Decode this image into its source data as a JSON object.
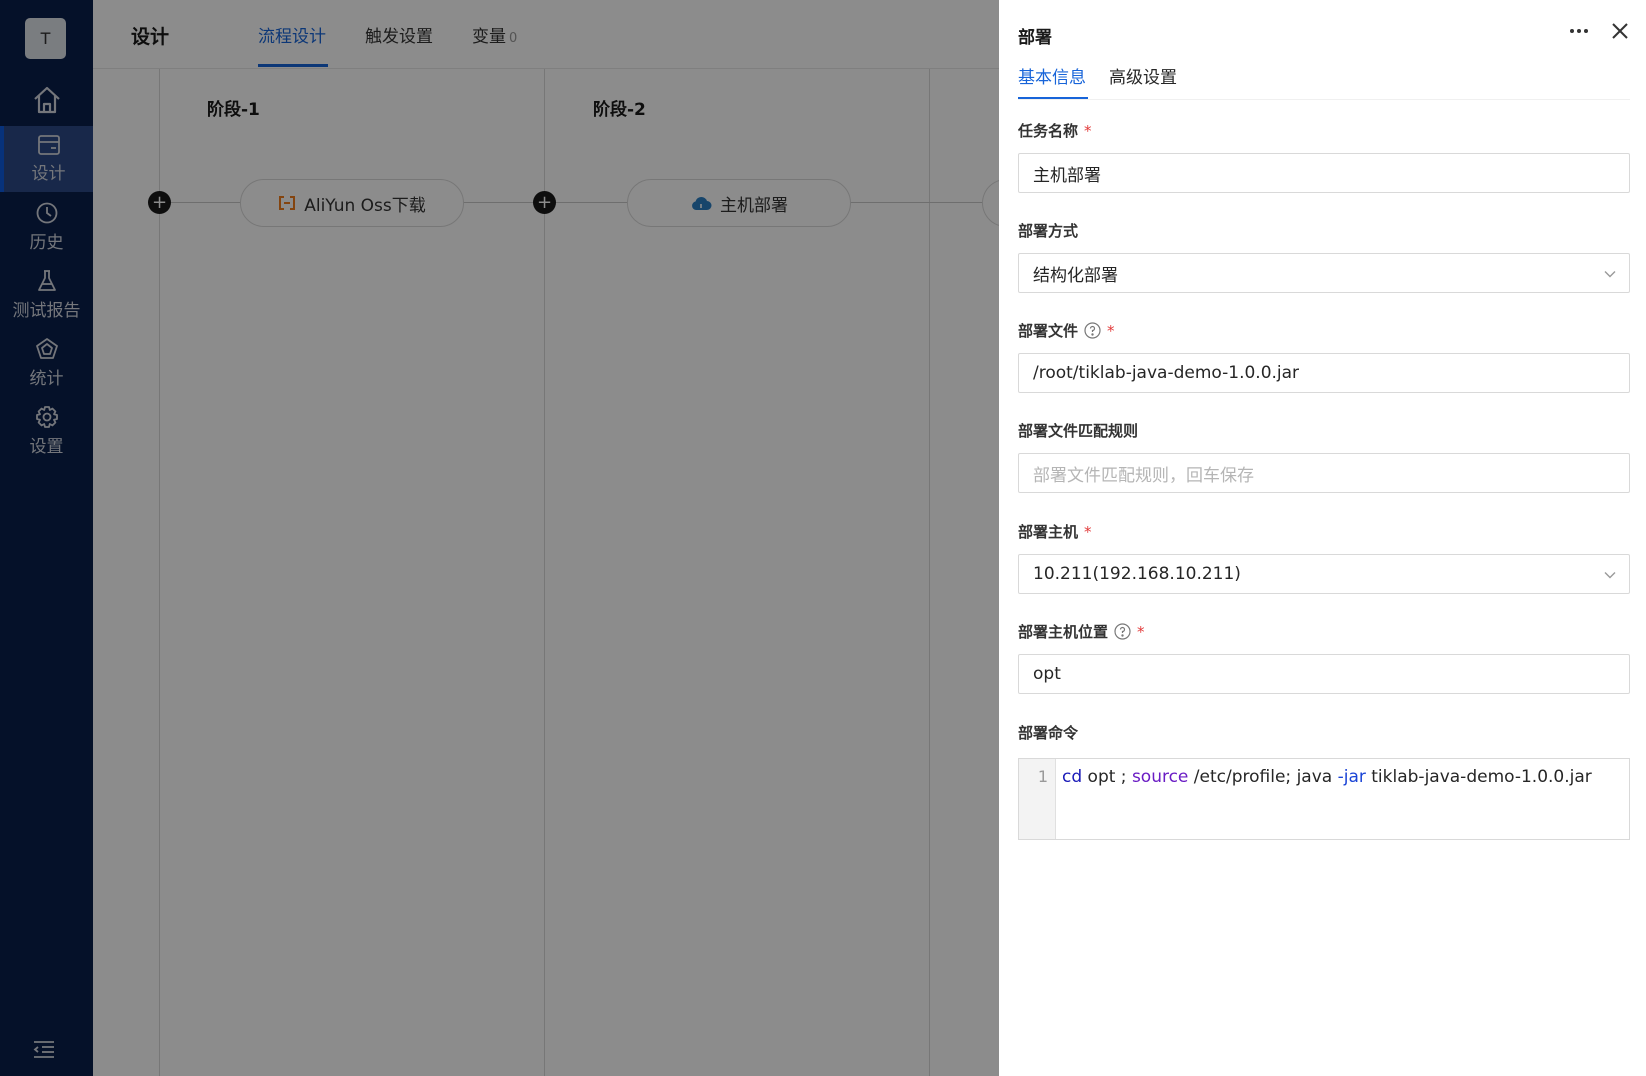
{
  "sidebar": {
    "avatar": "T",
    "items": [
      {
        "label": "设计",
        "icon": "design-icon",
        "active": true
      },
      {
        "label": "历史",
        "icon": "history-icon"
      },
      {
        "label": "测试报告",
        "icon": "flask-icon"
      },
      {
        "label": "统计",
        "icon": "statistics-icon"
      },
      {
        "label": "设置",
        "icon": "gear-icon"
      }
    ]
  },
  "header": {
    "title": "设计",
    "tabs": [
      {
        "label": "流程设计",
        "active": true
      },
      {
        "label": "触发设置"
      },
      {
        "label": "变量",
        "count": "0"
      }
    ]
  },
  "pipeline": {
    "stages": [
      {
        "title": "阶段-1",
        "task": "AliYun Oss下载",
        "task_icon": "aliyun-icon"
      },
      {
        "title": "阶段-2",
        "task": "主机部署",
        "task_icon": "cloud-icon"
      }
    ]
  },
  "drawer": {
    "title": "部署",
    "tabs": [
      {
        "label": "基本信息",
        "active": true
      },
      {
        "label": "高级设置"
      }
    ],
    "fields": {
      "task_name": {
        "label": "任务名称",
        "required": true,
        "value": "主机部署"
      },
      "deploy_mode": {
        "label": "部署方式",
        "value": "结构化部署"
      },
      "deploy_file": {
        "label": "部署文件",
        "required": true,
        "help": true,
        "value": "/root/tiklab-java-demo-1.0.0.jar"
      },
      "file_rule": {
        "label": "部署文件匹配规则",
        "placeholder": "部署文件匹配规则，回车保存"
      },
      "host": {
        "label": "部署主机",
        "required": true,
        "value": "10.211(192.168.10.211)"
      },
      "host_location": {
        "label": "部署主机位置",
        "required": true,
        "help": true,
        "value": "opt"
      },
      "command": {
        "label": "部署命令",
        "line_number": "1",
        "tokens": [
          "cd",
          " opt ; ",
          "source",
          " /etc/profile; java ",
          "-jar",
          " tiklab-java-demo-1.0.0.jar"
        ]
      }
    }
  },
  "colors": {
    "sidebar_bg": "#0a1f4b",
    "sidebar_active": "#2c4a87",
    "accent": "#1764d9",
    "required": "#e23b3b",
    "aliyun": "#f07c1d",
    "cloud": "#2b7fc4"
  }
}
